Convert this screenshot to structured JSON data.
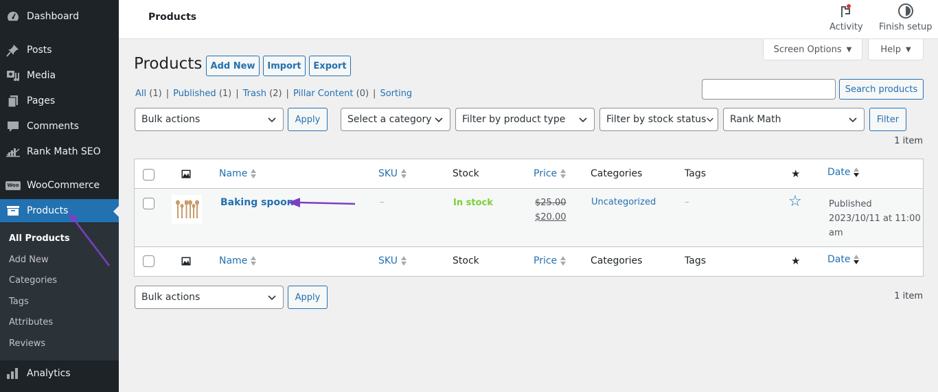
{
  "sidebar": {
    "items": [
      {
        "label": "Dashboard",
        "icon": "dashboard-icon"
      },
      {
        "label": "Posts",
        "icon": "pin-icon"
      },
      {
        "label": "Media",
        "icon": "media-icon"
      },
      {
        "label": "Pages",
        "icon": "pages-icon"
      },
      {
        "label": "Comments",
        "icon": "comment-icon"
      },
      {
        "label": "Rank Math SEO",
        "icon": "rank-math-icon"
      },
      {
        "label": "WooCommerce",
        "icon": "woo-icon"
      },
      {
        "label": "Products",
        "icon": "archive-icon",
        "active": true
      },
      {
        "label": "Analytics",
        "icon": "bar-chart-icon"
      }
    ],
    "submenu": [
      "All Products",
      "Add New",
      "Categories",
      "Tags",
      "Attributes",
      "Reviews"
    ],
    "woo_badge": "Woo"
  },
  "topbar": {
    "title": "Products",
    "activity_label": "Activity",
    "finish_setup_label": "Finish setup",
    "activity_badge_color": "#d63638"
  },
  "meta_tabs": {
    "screen_options": "Screen Options",
    "help": "Help",
    "caret": "▼"
  },
  "header": {
    "title": "Products",
    "add_new": "Add New",
    "import": "Import",
    "export": "Export"
  },
  "views": [
    {
      "label": "All",
      "count": "(1)"
    },
    {
      "label": "Published",
      "count": "(1)"
    },
    {
      "label": "Trash",
      "count": "(2)"
    },
    {
      "label": "Pillar Content",
      "count": "(0)"
    },
    {
      "label": "Sorting",
      "count": ""
    }
  ],
  "search": {
    "value": "",
    "placeholder": "",
    "button": "Search products"
  },
  "filters": {
    "bulk_actions": "Bulk actions",
    "apply": "Apply",
    "category": "Select a category",
    "product_type": "Filter by product type",
    "stock_status": "Filter by stock status",
    "rank_math": "Rank Math",
    "filter_button": "Filter"
  },
  "item_count": "1 item",
  "table": {
    "columns": {
      "name": "Name",
      "sku": "SKU",
      "stock": "Stock",
      "price": "Price",
      "categories": "Categories",
      "tags": "Tags",
      "featured": "★",
      "date": "Date"
    },
    "rows": [
      {
        "name": "Baking spoon",
        "sku": "–",
        "stock": "In stock",
        "regular_price": "$25.00",
        "sale_price": "$20.00",
        "categories": "Uncategorized",
        "tags": "–",
        "featured": "☆",
        "date_status": "Published",
        "date": "2023/10/11 at 11:00",
        "date_suffix": "am"
      }
    ]
  },
  "colors": {
    "accent": "#2271b1",
    "sidebar_bg": "#1d2327",
    "in_stock": "#7ad03a",
    "annotation_arrow": "#7b3fc4"
  }
}
